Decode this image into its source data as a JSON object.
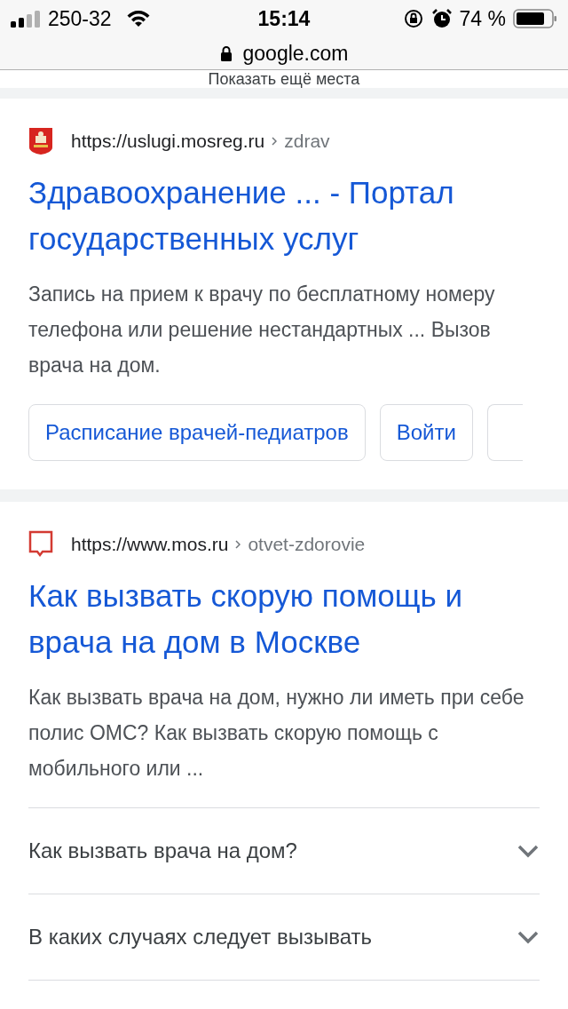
{
  "status_bar": {
    "carrier": "250-32",
    "time": "15:14",
    "battery": "74 %"
  },
  "address_bar": {
    "domain": "google.com"
  },
  "top_link": "Показать ещё места",
  "results": [
    {
      "kind": "emblem",
      "url": "https://uslugi.mosreg.ru",
      "path": "zdrav",
      "title": "Здравоохранение ... - Портал государственных услуг",
      "snippet": "Запись на прием к врачу по бесплатному номеру телефона или решение нестандартных ... Вызов врача на дом.",
      "chips": [
        "Расписание врачей-педиатров",
        "Войти"
      ]
    },
    {
      "kind": "bubble",
      "url": "https://www.mos.ru",
      "path": "otvet-zdorovie",
      "title": "Как вызвать скорую помощь и врача на дом в Москве",
      "snippet": "Как вызвать врача на дом, нужно ли иметь при себе полис ОМС? Как вызвать скорую помощь с мобильного или ...",
      "faq": [
        {
          "question": "Как вызвать врача на дом?",
          "expanded": false
        },
        {
          "question": "В каких случаях следует вызывать",
          "expanded": false
        }
      ]
    }
  ]
}
